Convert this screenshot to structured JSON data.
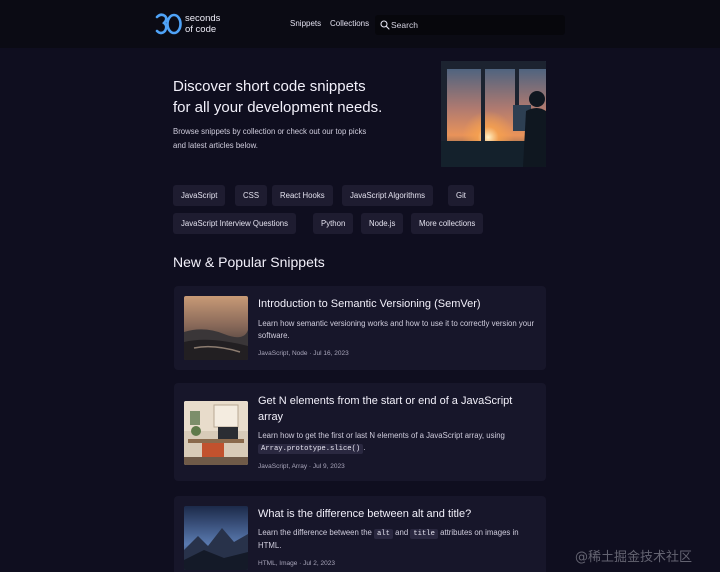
{
  "header": {
    "logo_text": "seconds\nof code",
    "nav": [
      "Snippets",
      "Collections"
    ],
    "search_placeholder": "Search"
  },
  "hero": {
    "title": "Discover short code snippets\nfor all your development needs.",
    "subtitle": "Browse snippets by collection or check out our top picks\nand latest articles below."
  },
  "tags": [
    "JavaScript",
    "CSS",
    "React Hooks",
    "JavaScript Algorithms",
    "Git",
    "JavaScript Interview Questions",
    "Python",
    "Node.js",
    "More collections"
  ],
  "section_title": "New & Popular Snippets",
  "cards": [
    {
      "title": "Introduction to Semantic Versioning (SemVer)",
      "desc": "Learn how semantic versioning works and how to use it to correctly version your software.",
      "meta": "JavaScript, Node · Jul 16, 2023"
    },
    {
      "title": "Get N elements from the start or end of a JavaScript array",
      "desc_pre": "Learn how to get the first or last N elements of a JavaScript array, using",
      "desc_code": "Array.prototype.slice()",
      "desc_post": ".",
      "meta": "JavaScript, Array · Jul 9, 2023"
    },
    {
      "title": "What is the difference between alt and title?",
      "desc_a": "Learn the difference between the",
      "code_alt": "alt",
      "desc_b": "and",
      "code_title": "title",
      "desc_c": "attributes on images in HTML.",
      "meta": "HTML, Image · Jul 2, 2023"
    }
  ],
  "watermark": "@稀土掘金技术社区",
  "colors": {
    "background": "#0f0e1f",
    "card": "#17162a",
    "tag": "#1e1c30",
    "logo_blue": "#4fa3f7"
  }
}
